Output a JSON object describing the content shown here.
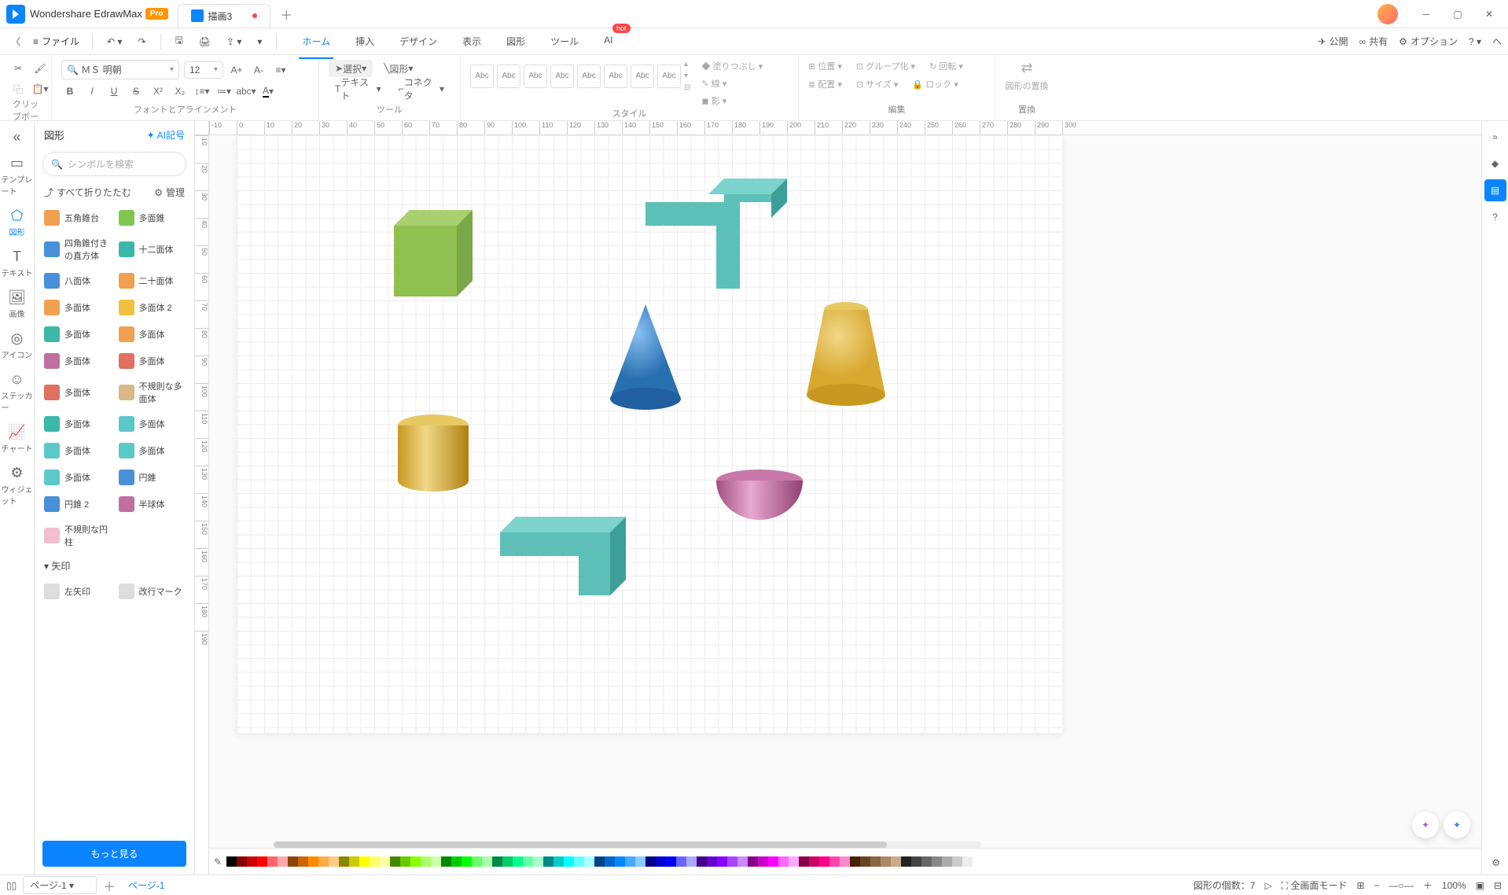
{
  "app": {
    "name": "Wondershare EdrawMax",
    "badge": "Pro"
  },
  "tab": {
    "name": "描画3"
  },
  "file_menu": "ファイル",
  "menu_tabs": [
    "ホーム",
    "挿入",
    "デザイン",
    "表示",
    "図形",
    "ツール",
    "AI"
  ],
  "hot": "hot",
  "right_menu": {
    "publish": "公開",
    "share": "共有",
    "options": "オプション"
  },
  "ribbon": {
    "clipboard": "クリップボード",
    "font": "フォントとアラインメント",
    "tool": "ツール",
    "style": "スタイル",
    "edit": "編集",
    "replace": "置換",
    "font_name": "ＭＳ 明朝",
    "font_size": "12",
    "select": "選択",
    "shape": "図形",
    "text": "テキスト",
    "connector": "コネクタ",
    "abc": "Abc",
    "fill": "塗りつぶし",
    "line": "線",
    "shadow": "影",
    "position": "位置",
    "group": "グループ化",
    "rotate": "回転",
    "arrange": "配置",
    "size": "サイズ",
    "lock": "ロック",
    "shape_replace": "図形の置換"
  },
  "rail": {
    "template": "テンプレート",
    "shapes": "図形",
    "text": "テキスト",
    "image": "画像",
    "icons": "アイコン",
    "sticker": "ステッカー",
    "chart": "チャート",
    "widget": "ウィジェット"
  },
  "shapes_panel": {
    "title": "図形",
    "ai_symbol": "AI記号",
    "search_ph": "シンボルを検索",
    "fold_all": "すべて折りたたむ",
    "manage": "管理",
    "more": "もっと見る",
    "items": [
      {
        "l": "五角錐台",
        "c": "#f0a050"
      },
      {
        "l": "多面錐",
        "c": "#7ec850"
      },
      {
        "l": "四角錐付きの直方体",
        "c": "#4a90d9"
      },
      {
        "l": "十二面体",
        "c": "#3cb8a8"
      },
      {
        "l": "八面体",
        "c": "#4a90d9"
      },
      {
        "l": "二十面体",
        "c": "#f0a050"
      },
      {
        "l": "多面体",
        "c": "#f0a050"
      },
      {
        "l": "多面体 2",
        "c": "#f0c040"
      },
      {
        "l": "多面体",
        "c": "#3cb8a8"
      },
      {
        "l": "多面体",
        "c": "#f0a050"
      },
      {
        "l": "多面体",
        "c": "#c070a0"
      },
      {
        "l": "多面体",
        "c": "#e07060"
      },
      {
        "l": "多面体",
        "c": "#e07060"
      },
      {
        "l": "不規則な多面体",
        "c": "#d8b888"
      },
      {
        "l": "多面体",
        "c": "#3cb8a8"
      },
      {
        "l": "多面体",
        "c": "#5cc8c8"
      },
      {
        "l": "多面体",
        "c": "#5cc8c8"
      },
      {
        "l": "多面体",
        "c": "#5cc8c8"
      },
      {
        "l": "多面体",
        "c": "#5cc8c8"
      },
      {
        "l": "円錐",
        "c": "#4a90d9"
      },
      {
        "l": "円錐 2",
        "c": "#4a90d9"
      },
      {
        "l": "半球体",
        "c": "#c070a0"
      },
      {
        "l": "不規則な円柱",
        "c": "#f0c0d0"
      }
    ],
    "cat_arrow": "矢印",
    "sub1": "左矢印",
    "sub2": "改行マーク"
  },
  "ruler_h": [
    "-10",
    "0",
    "10",
    "20",
    "30",
    "40",
    "50",
    "60",
    "70",
    "80",
    "90",
    "100",
    "110",
    "120",
    "130",
    "140",
    "150",
    "160",
    "170",
    "180",
    "190",
    "200",
    "210",
    "220",
    "230",
    "240",
    "250",
    "260",
    "270",
    "280",
    "290",
    "300"
  ],
  "ruler_v": [
    "10",
    "20",
    "30",
    "40",
    "50",
    "60",
    "70",
    "80",
    "90",
    "100",
    "110",
    "120",
    "130",
    "140",
    "150",
    "160",
    "170",
    "180",
    "190"
  ],
  "status": {
    "page_sel": "ページ-1",
    "page_tab": "ページ-1",
    "shape_count_label": "図形の個数：",
    "shape_count": "7",
    "fullscreen": "全画面モード",
    "zoom": "100%"
  },
  "colors": [
    "#000000",
    "#880000",
    "#cc0000",
    "#ff0000",
    "#ff6666",
    "#ffaaaa",
    "#884400",
    "#cc6600",
    "#ff8800",
    "#ffaa44",
    "#ffcc88",
    "#888800",
    "#cccc00",
    "#ffff00",
    "#ffff66",
    "#ffffaa",
    "#448800",
    "#66cc00",
    "#88ff00",
    "#aaff66",
    "#ccffaa",
    "#008800",
    "#00cc00",
    "#00ff00",
    "#66ff66",
    "#aaffaa",
    "#008844",
    "#00cc66",
    "#00ff88",
    "#66ffaa",
    "#aaffcc",
    "#008888",
    "#00cccc",
    "#00ffff",
    "#66ffff",
    "#aaffff",
    "#004488",
    "#0066cc",
    "#0088ff",
    "#44aaff",
    "#88ccff",
    "#000088",
    "#0000cc",
    "#0000ff",
    "#6666ff",
    "#aaaaff",
    "#440088",
    "#6600cc",
    "#8800ff",
    "#aa44ff",
    "#cc88ff",
    "#880088",
    "#cc00cc",
    "#ff00ff",
    "#ff66ff",
    "#ffaaff",
    "#880044",
    "#cc0066",
    "#ff0088",
    "#ff44aa",
    "#ff88cc",
    "#442200",
    "#664422",
    "#886644",
    "#aa8866",
    "#ccaa88",
    "#222222",
    "#444444",
    "#666666",
    "#888888",
    "#aaaaaa",
    "#cccccc",
    "#eeeeee",
    "#ffffff"
  ]
}
